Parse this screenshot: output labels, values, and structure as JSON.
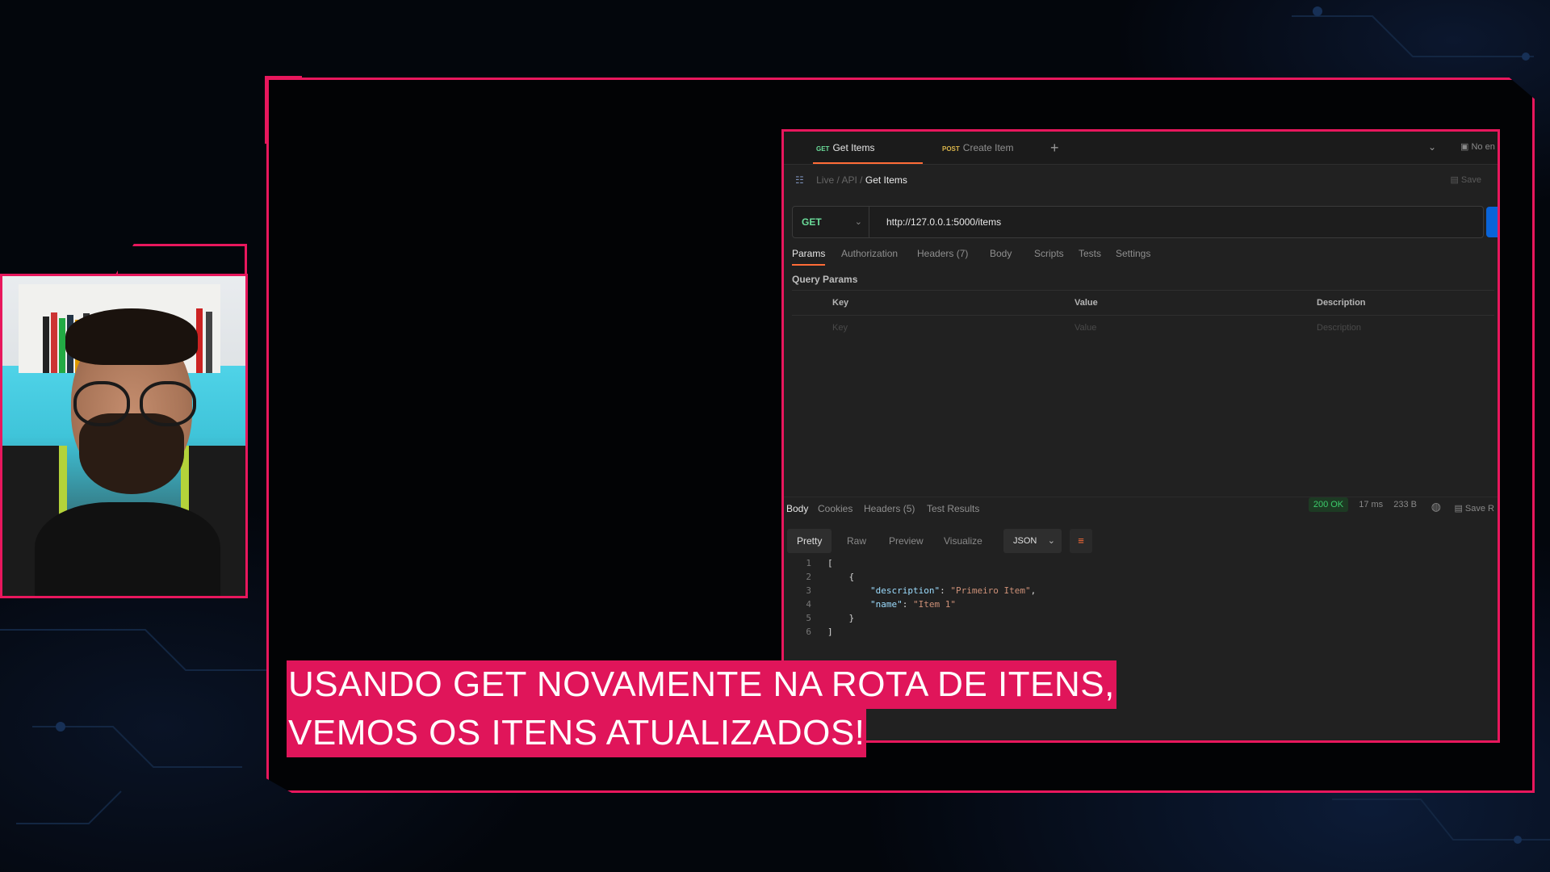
{
  "colors": {
    "accent": "#e8175d",
    "subtitle_bg": "#e0155a",
    "postman_orange": "#ff6c37",
    "status_ok": "#3ccc6b"
  },
  "postman": {
    "tabs": [
      {
        "method": "GET",
        "label": "Get Items",
        "active": true
      },
      {
        "method": "POST",
        "label": "Create Item",
        "active": false
      }
    ],
    "workspace_label": "No en",
    "breadcrumb": {
      "root": "Live",
      "folder": "API",
      "current": "Get Items",
      "sep": "/"
    },
    "save_label": "Save",
    "request": {
      "method": "GET",
      "url": "http://127.0.0.1:5000/items"
    },
    "request_tabs": [
      "Params",
      "Authorization",
      "Headers (7)",
      "Body",
      "Scripts",
      "Tests",
      "Settings"
    ],
    "query_params": {
      "title": "Query Params",
      "headers": [
        "Key",
        "Value",
        "Description"
      ],
      "placeholders": [
        "Key",
        "Value",
        "Description"
      ]
    },
    "response_tabs": [
      "Body",
      "Cookies",
      "Headers (5)",
      "Test Results"
    ],
    "status": {
      "code": "200 OK",
      "time": "17 ms",
      "size": "233 B"
    },
    "save_response_label": "Save R",
    "format_tabs": [
      "Pretty",
      "Raw",
      "Preview",
      "Visualize"
    ],
    "format_selected": "JSON",
    "response_body": [
      {
        "n": "1",
        "indent": "",
        "text": "["
      },
      {
        "n": "2",
        "indent": "    ",
        "text": "{"
      },
      {
        "n": "3",
        "indent": "        ",
        "key": "\"description\"",
        "value": "\"Primeiro Item\"",
        "trail": ","
      },
      {
        "n": "4",
        "indent": "        ",
        "key": "\"name\"",
        "value": "\"Item 1\"",
        "trail": ""
      },
      {
        "n": "5",
        "indent": "    ",
        "text": "}"
      },
      {
        "n": "6",
        "indent": "",
        "text": "]"
      }
    ]
  },
  "subtitle": {
    "line1": "USANDO GET NOVAMENTE NA ROTA DE ITENS,",
    "line2": "VEMOS OS ITENS ATUALIZADOS!"
  },
  "icons": [
    "plus-icon",
    "chevron-down-icon",
    "environment-icon",
    "collection-icon",
    "save-icon",
    "globe-icon",
    "wrap-lines-icon"
  ]
}
